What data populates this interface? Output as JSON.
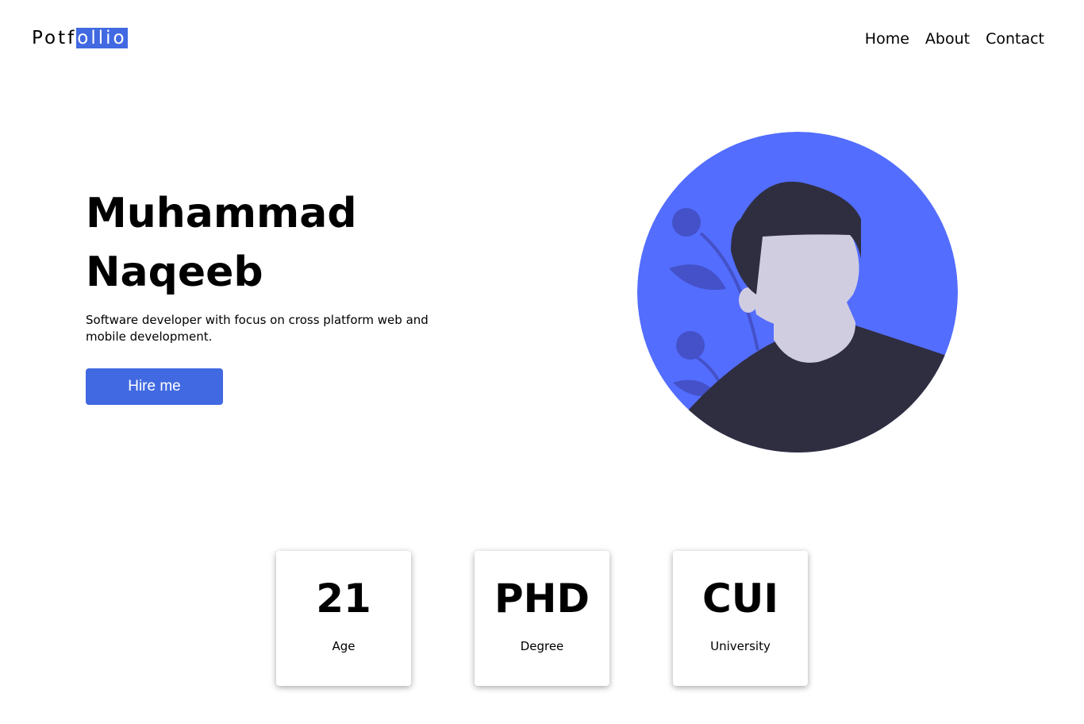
{
  "header": {
    "logo_plain": "Potf",
    "logo_highlight": "ollio",
    "nav": [
      "Home",
      "About",
      "Contact"
    ]
  },
  "hero": {
    "name_line1": "Muhammad",
    "name_line2": "Naqeeb",
    "description": "Software developer with focus on cross platform web and mobile development.",
    "cta_label": "Hire me"
  },
  "stats": [
    {
      "value": "21",
      "label": "Age"
    },
    {
      "value": "PHD",
      "label": "Degree"
    },
    {
      "value": "CUI",
      "label": "University"
    }
  ],
  "colors": {
    "accent": "#4169e1",
    "avatar_bg": "#536dfe",
    "avatar_dark": "#2f2e41",
    "avatar_skin": "#d0cde1"
  }
}
